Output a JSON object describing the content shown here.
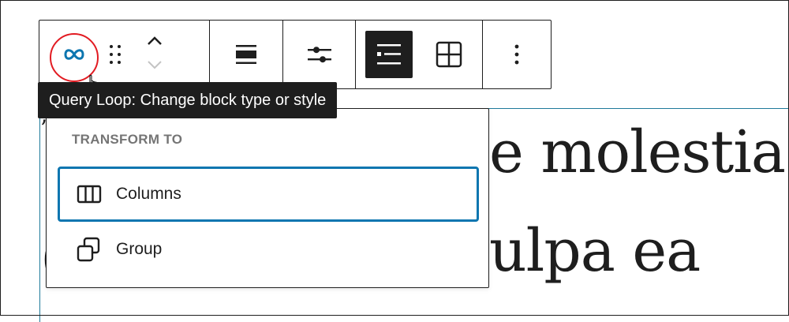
{
  "toolbar": {
    "buttons": [
      {
        "name": "query-loop-icon"
      },
      {
        "name": "drag-handle-icon"
      },
      {
        "name": "move-up-icon"
      },
      {
        "name": "move-down-icon"
      },
      {
        "name": "align-icon"
      },
      {
        "name": "settings-sliders-icon"
      },
      {
        "name": "list-view-icon",
        "active": true
      },
      {
        "name": "grid-view-icon"
      },
      {
        "name": "more-options-icon"
      }
    ]
  },
  "tooltip": {
    "text": "Query Loop: Change block type or style"
  },
  "dropdown": {
    "heading": "TRANSFORM TO",
    "items": [
      {
        "label": "Columns",
        "icon": "columns-icon",
        "focused": true
      },
      {
        "label": "Group",
        "icon": "group-icon",
        "focused": false
      }
    ]
  },
  "content": {
    "line1": "e molestia",
    "line2": "ulpa ea",
    "peek_top": "”",
    "peek_bottom": "("
  },
  "colors": {
    "accent": "#0d76b0",
    "dark": "#1e1e1e",
    "highlight_ring": "#e21b22",
    "heading_gray": "#757575",
    "block_border": "#1f7a9a"
  }
}
